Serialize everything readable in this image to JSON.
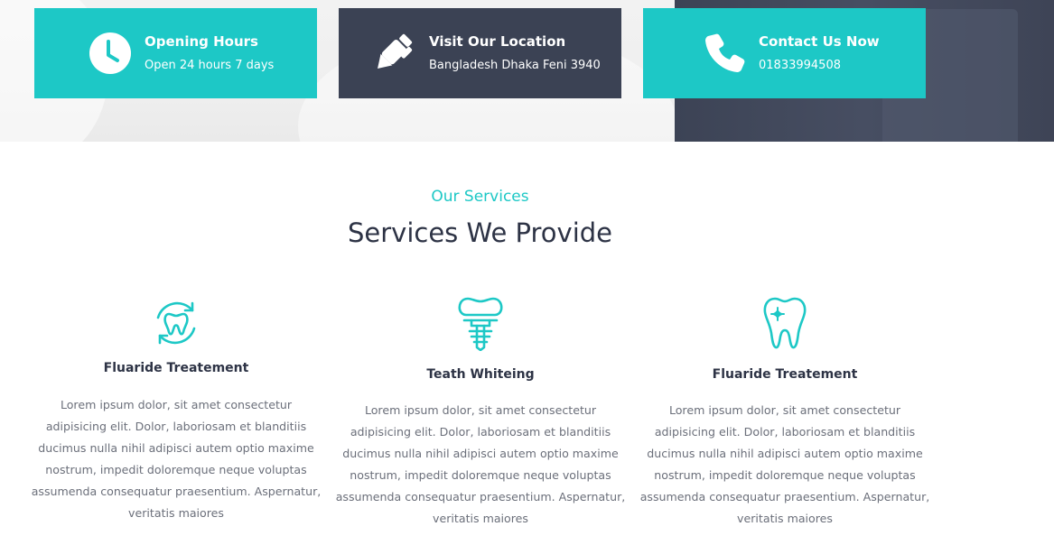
{
  "info_cards": [
    {
      "title": "Opening Hours",
      "subtitle": "Open 24 hours 7 days",
      "icon": "clock-icon"
    },
    {
      "title": "Visit Our Location",
      "subtitle": "Bangladesh Dhaka Feni 3940",
      "icon": "pen-icon"
    },
    {
      "title": "Contact Us Now",
      "subtitle": "01833994508",
      "icon": "phone-icon"
    }
  ],
  "services_section": {
    "eyebrow": "Our Services",
    "title": "Services We Provide",
    "items": [
      {
        "title": "Fluaride Treatement",
        "icon": "tooth-rotate-icon",
        "description": "Lorem ipsum dolor, sit amet consectetur adipisicing elit. Dolor, laboriosam et blanditiis ducimus nulla nihil adipisci autem optio maxime nostrum, impedit doloremque neque voluptas assumenda consequatur praesentium. Aspernatur, veritatis maiores"
      },
      {
        "title": "Teath Whiteing",
        "icon": "tooth-implant-icon",
        "description": "Lorem ipsum dolor, sit amet consectetur adipisicing elit. Dolor, laboriosam et blanditiis ducimus nulla nihil adipisci autem optio maxime nostrum, impedit doloremque neque voluptas assumenda consequatur praesentium. Aspernatur, veritatis maiores"
      },
      {
        "title": "Fluaride Treatement",
        "icon": "tooth-sparkle-icon",
        "description": "Lorem ipsum dolor, sit amet consectetur adipisicing elit. Dolor, laboriosam et blanditiis ducimus nulla nihil adipisci autem optio maxime nostrum, impedit doloremque neque voluptas assumenda consequatur praesentium. Aspernatur, veritatis maiores"
      }
    ]
  },
  "colors": {
    "accent": "#1dc8c6",
    "dark": "#3b4254",
    "heading": "#2d3345",
    "body_text": "#6b6f7a"
  }
}
